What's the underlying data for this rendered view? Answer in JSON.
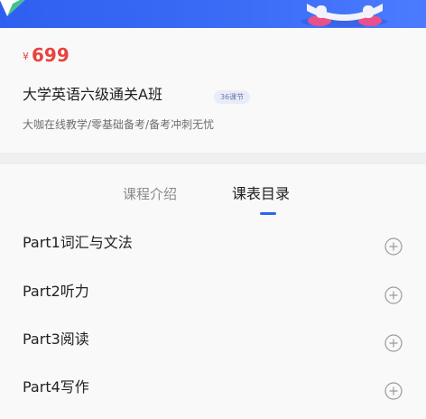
{
  "price": {
    "currency": "¥",
    "amount": "699"
  },
  "course": {
    "title": "大学英语六级通关A班",
    "lesson_badge": "36课节",
    "description": "大咖在线教学/零基础备考/备考冲刺无忧"
  },
  "tabs": [
    {
      "label": "课程介绍",
      "active": false
    },
    {
      "label": "课表目录",
      "active": true
    }
  ],
  "catalog": [
    {
      "label": "Part1词汇与文法",
      "icon": "plus-circle-icon"
    },
    {
      "label": "Part2听力",
      "icon": "plus-circle-icon"
    },
    {
      "label": "Part3阅读",
      "icon": "plus-circle-icon"
    },
    {
      "label": "Part4写作",
      "icon": "plus-circle-icon"
    }
  ],
  "colors": {
    "banner": "#3a6cf6",
    "price": "#e8423f",
    "accent": "#2f64f0",
    "badge_bg": "#e9ecf8",
    "badge_text": "#6b7aa8"
  }
}
